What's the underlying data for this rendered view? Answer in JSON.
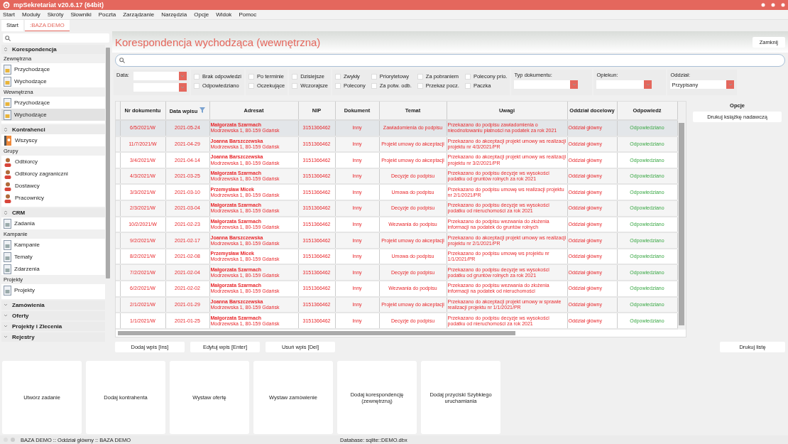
{
  "window": {
    "title": "mpSekretariat v20.6.17 (64bit)"
  },
  "menu": [
    "Start",
    "Moduły",
    "Skróty",
    "Słowniki",
    "Poczta",
    "Zarządzanie",
    "Narzędzia",
    "Opcje",
    "Widok",
    "Pomoc"
  ],
  "tabs": [
    {
      "label": "Start",
      "selected": false
    },
    {
      "label": ":BAZA DEMO",
      "selected": true
    }
  ],
  "sidebar": {
    "sections": [
      {
        "title": "Korespondencja",
        "expanded": true,
        "groups": [
          {
            "label": "Zewnętrzna",
            "items": [
              {
                "label": "Przychodzące",
                "selected": false
              },
              {
                "label": "Wychodzące",
                "selected": false
              }
            ]
          },
          {
            "label": "Wewnętrzna",
            "items": [
              {
                "label": "Przychodzące",
                "selected": false
              },
              {
                "label": "Wychodzące",
                "selected": true
              }
            ]
          }
        ]
      },
      {
        "title": "Kontrahenci",
        "expanded": true,
        "groups": [
          {
            "items": [
              {
                "label": "Wszyscy",
                "selected": false
              }
            ]
          },
          {
            "label": "Grupy",
            "items": [
              {
                "label": "Odbiorcy",
                "selected": false
              },
              {
                "label": "Odbiorcy zagraniczni",
                "selected": false
              },
              {
                "label": "Dostawcy",
                "selected": false
              },
              {
                "label": "Pracownicy",
                "selected": false
              }
            ]
          }
        ]
      },
      {
        "title": "CRM",
        "expanded": true,
        "groups": [
          {
            "items": [
              {
                "label": "Zadania",
                "selected": false
              }
            ]
          },
          {
            "label": "Kampanie",
            "items": [
              {
                "label": "Kampanie",
                "selected": false
              },
              {
                "label": "Tematy",
                "selected": false
              },
              {
                "label": "Zdarzenia",
                "selected": false
              }
            ]
          },
          {
            "label": "Projekty",
            "items": [
              {
                "label": "Projekty",
                "selected": false
              }
            ]
          }
        ]
      },
      {
        "title": "Zamówienia",
        "expanded": false
      },
      {
        "title": "Oferty",
        "expanded": false
      },
      {
        "title": "Projekty i Zlecenia",
        "expanded": false
      },
      {
        "title": "Rejestry",
        "expanded": false
      }
    ]
  },
  "page": {
    "title": "Korespondencja wychodząca (wewnętrzna)",
    "close_button": "Zamknij"
  },
  "filters": {
    "date_label": "Data:",
    "checkbox_groups": [
      [
        {
          "label": "Brak odpowiedzi",
          "checked": false
        },
        {
          "label": "Odpowiedziano",
          "checked": false
        }
      ],
      [
        {
          "label": "Po terminie",
          "checked": false
        },
        {
          "label": "Oczekujące",
          "checked": false
        }
      ],
      [
        {
          "label": "Dzisiejsze",
          "checked": false
        },
        {
          "label": "Wczorajsze",
          "checked": false
        }
      ],
      [
        {
          "label": "Zwykły",
          "checked": false
        },
        {
          "label": "Polecony",
          "checked": false
        },
        {
          "label": "Priorytetowy",
          "checked": false
        },
        {
          "label": "Za potw. odb.",
          "checked": false
        },
        {
          "label": "Za pobraniem",
          "checked": false
        },
        {
          "label": "Przekaz pocz.",
          "checked": false
        },
        {
          "label": "Polecony prio.",
          "checked": false
        },
        {
          "label": "Paczka",
          "checked": false
        }
      ]
    ],
    "dropdowns": [
      {
        "label": "Typ dokumentu:"
      },
      {
        "label": "Opiekun:"
      },
      {
        "label": "Oddział:",
        "value": "Przypisany"
      }
    ]
  },
  "table": {
    "columns": [
      {
        "label": "Nr dokumentu",
        "filtered": false
      },
      {
        "label": "Data wpisu",
        "filtered": true
      },
      {
        "label": "Adresat",
        "filtered": false
      },
      {
        "label": "NIP",
        "filtered": false
      },
      {
        "label": "Dokument",
        "filtered": false
      },
      {
        "label": "Temat",
        "filtered": false
      },
      {
        "label": "Uwagi",
        "filtered": false
      },
      {
        "label": "Oddział docelowy",
        "filtered": false
      },
      {
        "label": "Odpowiedź",
        "filtered": false
      }
    ],
    "rows": [
      {
        "selected": true,
        "nr": "6/5/2021/W",
        "date": "2021-05-24",
        "name": "Małgorzata Szarmach",
        "address": "Modrzewska 1, 80-159 Gdańsk",
        "nip": "3151366462",
        "document": "Inny",
        "subject": "Zawiadomienia do podpisu",
        "notes": "Przekazano do podpisu zawiadomienia o nieodnotowaniu płatności na podatek za rok 2021",
        "branch": "Oddział główny",
        "reply": "Odpowiedziano"
      },
      {
        "selected": false,
        "nr": "11/7/2021/W",
        "date": "2021-04-29",
        "name": "Joanna Barszczewska",
        "address": "Modrzewska 1, 80-159 Gdańsk",
        "nip": "3151366462",
        "document": "Inny",
        "subject": "Projekt umowy do akceptacji",
        "notes": "Przekazano do akceptacji projekt umowy ws realizacji projektu nr 4/3/2021/PR",
        "branch": "Oddział główny",
        "reply": "Odpowiedziano"
      },
      {
        "selected": false,
        "nr": "3/4/2021/W",
        "date": "2021-04-14",
        "name": "Joanna Barszczewska",
        "address": "Modrzewska 1, 80-159 Gdańsk",
        "nip": "3151366462",
        "document": "Inny",
        "subject": "Projekt umowy do akceptacji",
        "notes": "Przekazano do akceptacji projekt umowy ws realizacji projektu nr 3/2/2021/PR",
        "branch": "Oddział główny",
        "reply": "Odpowiedziano"
      },
      {
        "selected": false,
        "nr": "4/3/2021/W",
        "date": "2021-03-25",
        "name": "Małgorzata Szarmach",
        "address": "Modrzewska 1, 80-159 Gdańsk",
        "nip": "3151366462",
        "document": "Inny",
        "subject": "Decyzje do podpisu",
        "notes": "Przekazano do podpisu decyzje ws wysokości podatku od gruntów rolnych za rok 2021",
        "branch": "Oddział główny",
        "reply": "Odpowiedziano"
      },
      {
        "selected": false,
        "nr": "3/3/2021/W",
        "date": "2021-03-10",
        "name": "Przemysław Micek",
        "address": "Modrzewska 1, 80-159 Gdańsk",
        "nip": "3151366462",
        "document": "Inny",
        "subject": "Umowa do podpisu",
        "notes": "Przekazano do podpisu umowę ws realizacji projektu nr 2/1/2021/PR",
        "branch": "Oddział główny",
        "reply": "Odpowiedziano"
      },
      {
        "selected": false,
        "nr": "2/3/2021/W",
        "date": "2021-03-04",
        "name": "Małgorzata Szarmach",
        "address": "Modrzewska 1, 80-159 Gdańsk",
        "nip": "3151366462",
        "document": "Inny",
        "subject": "Decyzje do podpisu",
        "notes": "Przekazano do podpisu decyzje ws wysokości podatku od nieruchomości za rok 2021",
        "branch": "Oddział główny",
        "reply": "Odpowiedziano"
      },
      {
        "selected": false,
        "nr": "10/2/2021/W",
        "date": "2021-02-23",
        "name": "Małgorzata Szarmach",
        "address": "Modrzewska 1, 80-159 Gdańsk",
        "nip": "3151366462",
        "document": "Inny",
        "subject": "Wezwania do podpisu",
        "notes": "Przekazano do podpisu wezwania do złożenia informacji na podatek do gruntów rolnych",
        "branch": "Oddział główny",
        "reply": "Odpowiedziano"
      },
      {
        "selected": false,
        "nr": "9/2/2021/W",
        "date": "2021-02-17",
        "name": "Joanna Barszczewska",
        "address": "Modrzewska 1, 80-159 Gdańsk",
        "nip": "3151366462",
        "document": "Inny",
        "subject": "Projekt umowy do akceptacji",
        "notes": "Przekazano do akceptacji projekt umowy ws realizacji projektu nr 2/1/2021/PR",
        "branch": "Oddział główny",
        "reply": "Odpowiedziano"
      },
      {
        "selected": false,
        "nr": "8/2/2021/W",
        "date": "2021-02-08",
        "name": "Przemysław Micek",
        "address": "Modrzewska 1, 80-159 Gdańsk",
        "nip": "3151366462",
        "document": "Inny",
        "subject": "Umowa do podpisu",
        "notes": "Przekazano do podpisu umowę ws projektu nr 1/1/2021/PR",
        "branch": "Oddział główny",
        "reply": "Odpowiedziano"
      },
      {
        "selected": false,
        "nr": "7/2/2021/W",
        "date": "2021-02-04",
        "name": "Małgorzata Szarmach",
        "address": "Modrzewska 1, 80-159 Gdańsk",
        "nip": "3151366462",
        "document": "Inny",
        "subject": "Decyzje do podpisu",
        "notes": "Przekazano do podpisu decyzje ws wysokości podatku od gruntów rolnych za rok 2021",
        "branch": "Oddział główny",
        "reply": "Odpowiedziano"
      },
      {
        "selected": false,
        "nr": "6/2/2021/W",
        "date": "2021-02-02",
        "name": "Małgorzata Szarmach",
        "address": "Modrzewska 1, 80-159 Gdańsk",
        "nip": "3151366462",
        "document": "Inny",
        "subject": "Wezwania do podpisu",
        "notes": "Przekazano do podpisu wezwania do złożenia informacji na podatek od nieruchomości",
        "branch": "Oddział główny",
        "reply": "Odpowiedziano"
      },
      {
        "selected": false,
        "nr": "2/1/2021/W",
        "date": "2021-01-29",
        "name": "Joanna Barszczewska",
        "address": "Modrzewska 1, 80-159 Gdańsk",
        "nip": "3151366462",
        "document": "Inny",
        "subject": "Projekt umowy do akceptacji",
        "notes": "Przekazano do akceptacji projekt umowy w sprawie realizacji projektu nr 1/1/2021/PR",
        "branch": "Oddział główny",
        "reply": "Odpowiedziano"
      },
      {
        "selected": false,
        "nr": "1/1/2021/W",
        "date": "2021-01-25",
        "name": "Małgorzata Szarmach",
        "address": "Modrzewska 1, 80-159 Gdańsk",
        "nip": "3151366462",
        "document": "Inny",
        "subject": "Decyzje do podpisu",
        "notes": "Przekazano do podpisu decyzje ws wysokości podatku od nieruchomości za rok 2021",
        "branch": "Oddział główny",
        "reply": "Odpowiedziano"
      }
    ]
  },
  "options": {
    "title": "Opcje",
    "buttons": [
      "Drukuj książkę nadawczą"
    ]
  },
  "actions": [
    "Dodaj wpis [Ins]",
    "Edytuj wpis [Enter]",
    "Usuń wpis [Del]"
  ],
  "print_list_button": "Drukuj listę",
  "tiles": [
    "Utwórz zadanie",
    "Dodaj kontrahenta",
    "Wystaw ofertę",
    "Wystaw zamówienie",
    "Dodaj korespondencję (zewnętrzną)",
    "Dodaj przyciski Szybkiego uruchamiania"
  ],
  "status_bar": {
    "left": "BAZA DEMO :: Oddział główny :: BAZA DEMO",
    "right": "Database: sqlite::DEMO.dbx"
  }
}
